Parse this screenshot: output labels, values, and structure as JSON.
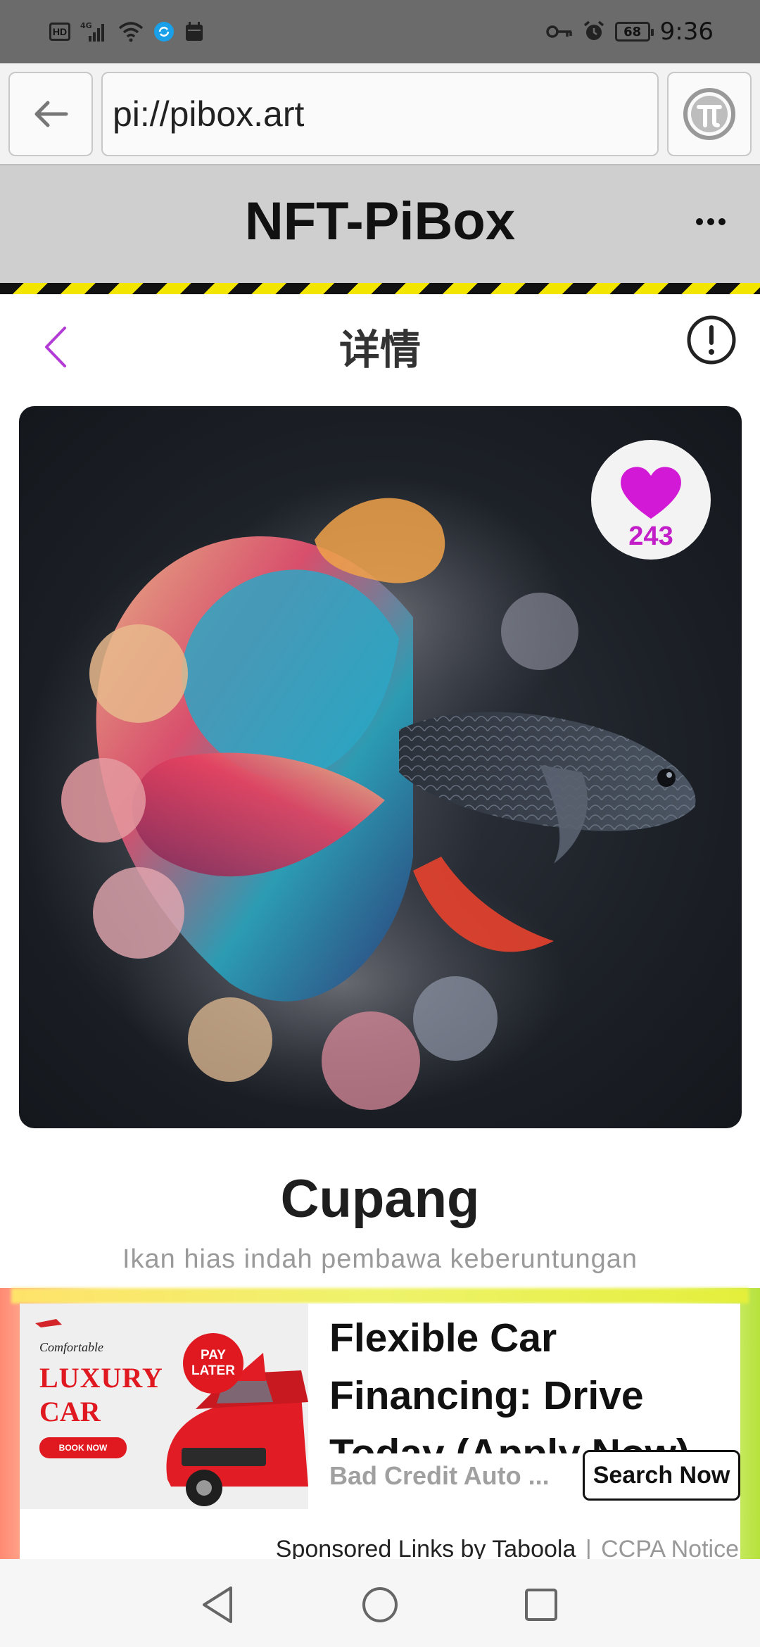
{
  "status_bar": {
    "time": "9:36",
    "battery": "68",
    "network": "4G",
    "hd_label": "HD"
  },
  "browser": {
    "url": "pi://pibox.art"
  },
  "app": {
    "title": "NFT-PiBox"
  },
  "detail": {
    "title": "详情",
    "likes": "243",
    "name": "Cupang",
    "description": "Ikan hias indah pembawa keberuntungan"
  },
  "ad": {
    "image_text": {
      "comfortable": "Comfortable",
      "luxury": "LUXURY",
      "car": "CAR",
      "book_now": "BOOK NOW",
      "pay": "PAY",
      "later": "LATER"
    },
    "headline": "Flexible Car Financing: Drive Today (Apply Now)",
    "source": "Bad Credit Auto ...",
    "cta": "Search Now",
    "sponsored": "Sponsored Links by Taboola",
    "separator": "|",
    "ccpa": "CCPA Notice"
  },
  "colors": {
    "accent": "#c21fc8",
    "status_bar": "#6b6b6b",
    "header_bg": "#cfcfcf",
    "hazard_yellow": "#f2e500"
  },
  "icons": {
    "back": "arrow-left-icon",
    "pi": "pi-network-icon",
    "more": "more-horizontal-icon",
    "detail_back": "chevron-left-icon",
    "info": "exclamation-circle-icon",
    "like": "heart-icon",
    "nav_back": "triangle-back-icon",
    "nav_home": "circle-home-icon",
    "nav_recent": "square-recent-icon"
  }
}
